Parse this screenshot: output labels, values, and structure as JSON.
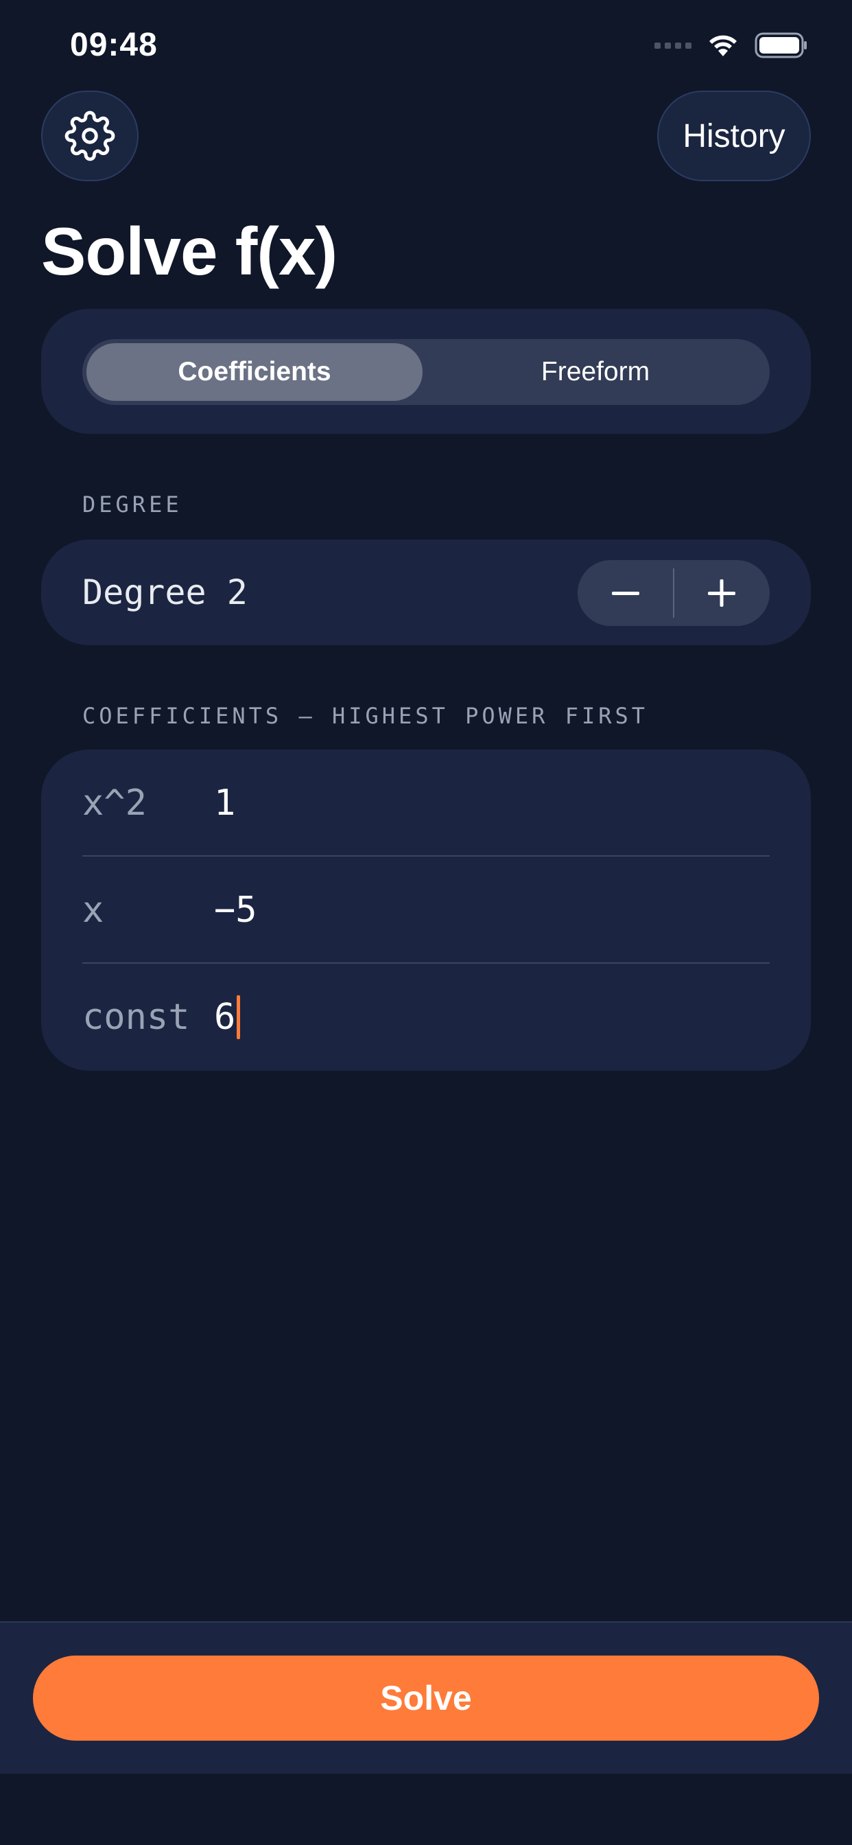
{
  "status_bar": {
    "time": "09:48"
  },
  "header": {
    "history_label": "History",
    "title": "Solve f(x)"
  },
  "mode_tabs": {
    "active": "Coefficients",
    "inactive": "Freeform"
  },
  "degree_section": {
    "label": "DEGREE",
    "value_label": "Degree 2"
  },
  "coefficients_section": {
    "label": "COEFFICIENTS — HIGHEST POWER FIRST",
    "rows": [
      {
        "name": "x^2",
        "value": "1"
      },
      {
        "name": "x",
        "value": "−5"
      },
      {
        "name": "const",
        "value": "6"
      }
    ]
  },
  "footer": {
    "solve_label": "Solve"
  },
  "colors": {
    "accent": "#ff7b39",
    "background": "#0f1729",
    "card": "#1b2541"
  }
}
